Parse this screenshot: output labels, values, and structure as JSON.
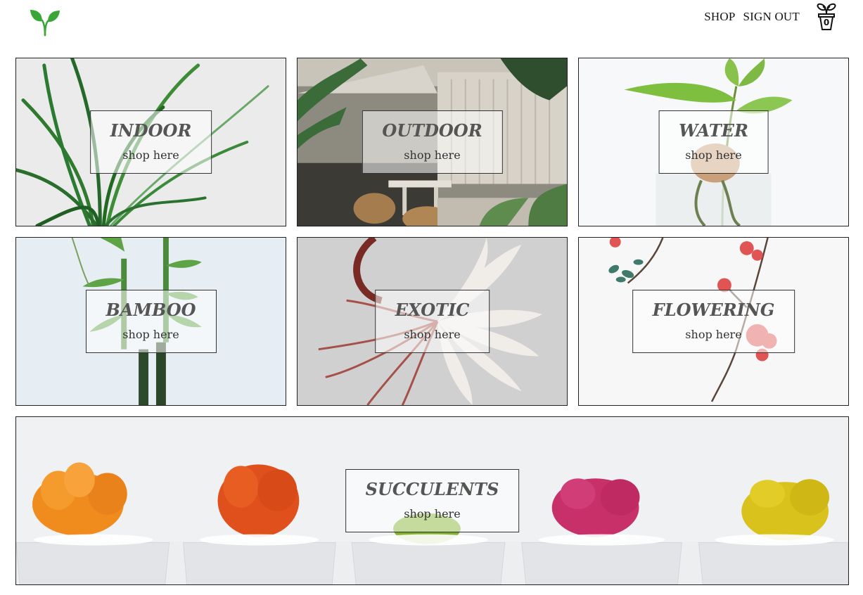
{
  "header": {
    "logo_icon": "leaf-sprout-icon",
    "logo_color": "#3aa635",
    "nav": {
      "shop_label": "SHOP",
      "sign_out_label": "SIGN OUT"
    },
    "cart": {
      "icon": "plant-pot-cart-icon",
      "count": "0"
    }
  },
  "categories": [
    {
      "title": "INDOOR",
      "subtitle": "shop here"
    },
    {
      "title": "OUTDOOR",
      "subtitle": "shop here"
    },
    {
      "title": "WATER",
      "subtitle": "shop here"
    },
    {
      "title": "BAMBOO",
      "subtitle": "shop here"
    },
    {
      "title": "EXOTIC",
      "subtitle": "shop here"
    },
    {
      "title": "FLOWERING",
      "subtitle": "shop here"
    },
    {
      "title": "SUCCULENTS",
      "subtitle": "shop here"
    }
  ]
}
